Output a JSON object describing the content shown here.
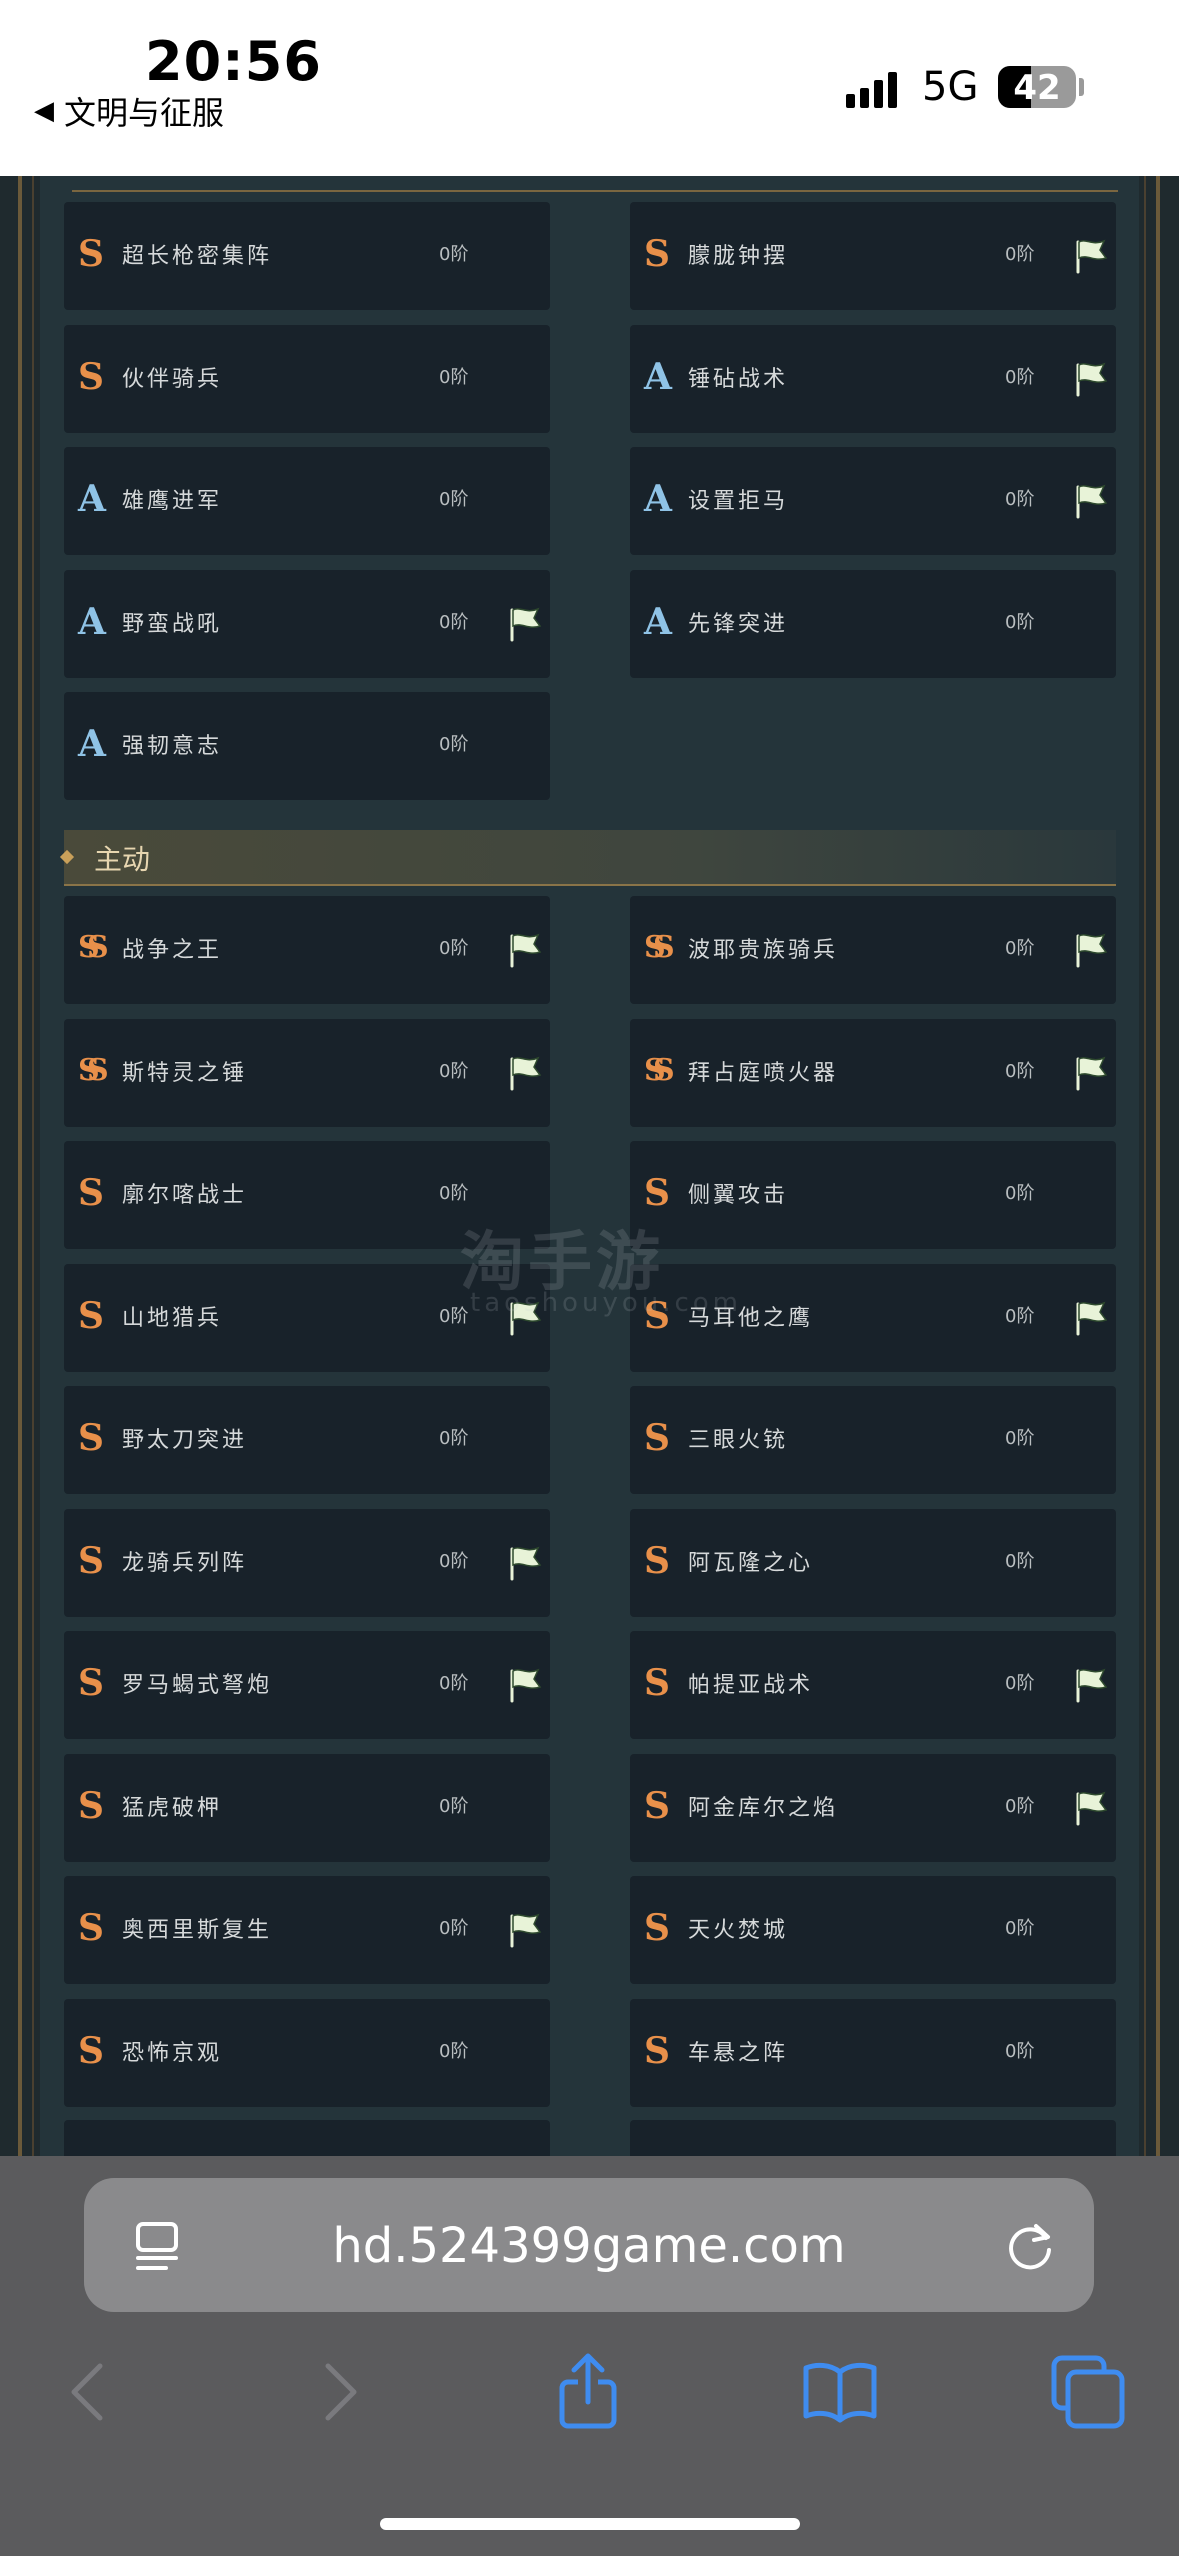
{
  "status": {
    "time": "20:56",
    "back_app": "文明与征服",
    "network": "5G",
    "battery": "42",
    "battery_level": 0.42
  },
  "top_cards": [
    {
      "grade": "S",
      "name": "超长枪密集阵",
      "level": "0阶",
      "flag": false
    },
    {
      "grade": "S",
      "name": "朦胧钟摆",
      "level": "0阶",
      "flag": true
    },
    {
      "grade": "S",
      "name": "伙伴骑兵",
      "level": "0阶",
      "flag": false
    },
    {
      "grade": "A",
      "name": "锤砧战术",
      "level": "0阶",
      "flag": true
    },
    {
      "grade": "A",
      "name": "雄鹰进军",
      "level": "0阶",
      "flag": false
    },
    {
      "grade": "A",
      "name": "设置拒马",
      "level": "0阶",
      "flag": true
    },
    {
      "grade": "A",
      "name": "野蛮战吼",
      "level": "0阶",
      "flag": true
    },
    {
      "grade": "A",
      "name": "先锋突进",
      "level": "0阶",
      "flag": false
    },
    {
      "grade": "A",
      "name": "强韧意志",
      "level": "0阶",
      "flag": false
    }
  ],
  "section_title": "主动",
  "active_cards": [
    {
      "grade": "SS",
      "name": "战争之王",
      "level": "0阶",
      "flag": true
    },
    {
      "grade": "SS",
      "name": "波耶贵族骑兵",
      "level": "0阶",
      "flag": true
    },
    {
      "grade": "SS",
      "name": "斯特灵之锤",
      "level": "0阶",
      "flag": true
    },
    {
      "grade": "SS",
      "name": "拜占庭喷火器",
      "level": "0阶",
      "flag": true
    },
    {
      "grade": "S",
      "name": "廓尔喀战士",
      "level": "0阶",
      "flag": false
    },
    {
      "grade": "S",
      "name": "侧翼攻击",
      "level": "0阶",
      "flag": false
    },
    {
      "grade": "S",
      "name": "山地猎兵",
      "level": "0阶",
      "flag": true
    },
    {
      "grade": "S",
      "name": "马耳他之鹰",
      "level": "0阶",
      "flag": true
    },
    {
      "grade": "S",
      "name": "野太刀突进",
      "level": "0阶",
      "flag": false
    },
    {
      "grade": "S",
      "name": "三眼火铳",
      "level": "0阶",
      "flag": false
    },
    {
      "grade": "S",
      "name": "龙骑兵列阵",
      "level": "0阶",
      "flag": true
    },
    {
      "grade": "S",
      "name": "阿瓦隆之心",
      "level": "0阶",
      "flag": false
    },
    {
      "grade": "S",
      "name": "罗马蝎式弩炮",
      "level": "0阶",
      "flag": true
    },
    {
      "grade": "S",
      "name": "帕提亚战术",
      "level": "0阶",
      "flag": true
    },
    {
      "grade": "S",
      "name": "猛虎破柙",
      "level": "0阶",
      "flag": false
    },
    {
      "grade": "S",
      "name": "阿金库尔之焰",
      "level": "0阶",
      "flag": true
    },
    {
      "grade": "S",
      "name": "奥西里斯复生",
      "level": "0阶",
      "flag": true
    },
    {
      "grade": "S",
      "name": "天火焚城",
      "level": "0阶",
      "flag": false
    },
    {
      "grade": "S",
      "name": "恐怖京观",
      "level": "0阶",
      "flag": false
    },
    {
      "grade": "S",
      "name": "车悬之阵",
      "level": "0阶",
      "flag": false
    }
  ],
  "watermark": "淘手游",
  "watermark_sub": "taoshouyou.com",
  "browser": {
    "url": "hd.524399game.com"
  },
  "colors": {
    "grade_S": "#e8904a",
    "grade_A": "#8fc3e6",
    "ios_blue": "#3f8cf0"
  }
}
